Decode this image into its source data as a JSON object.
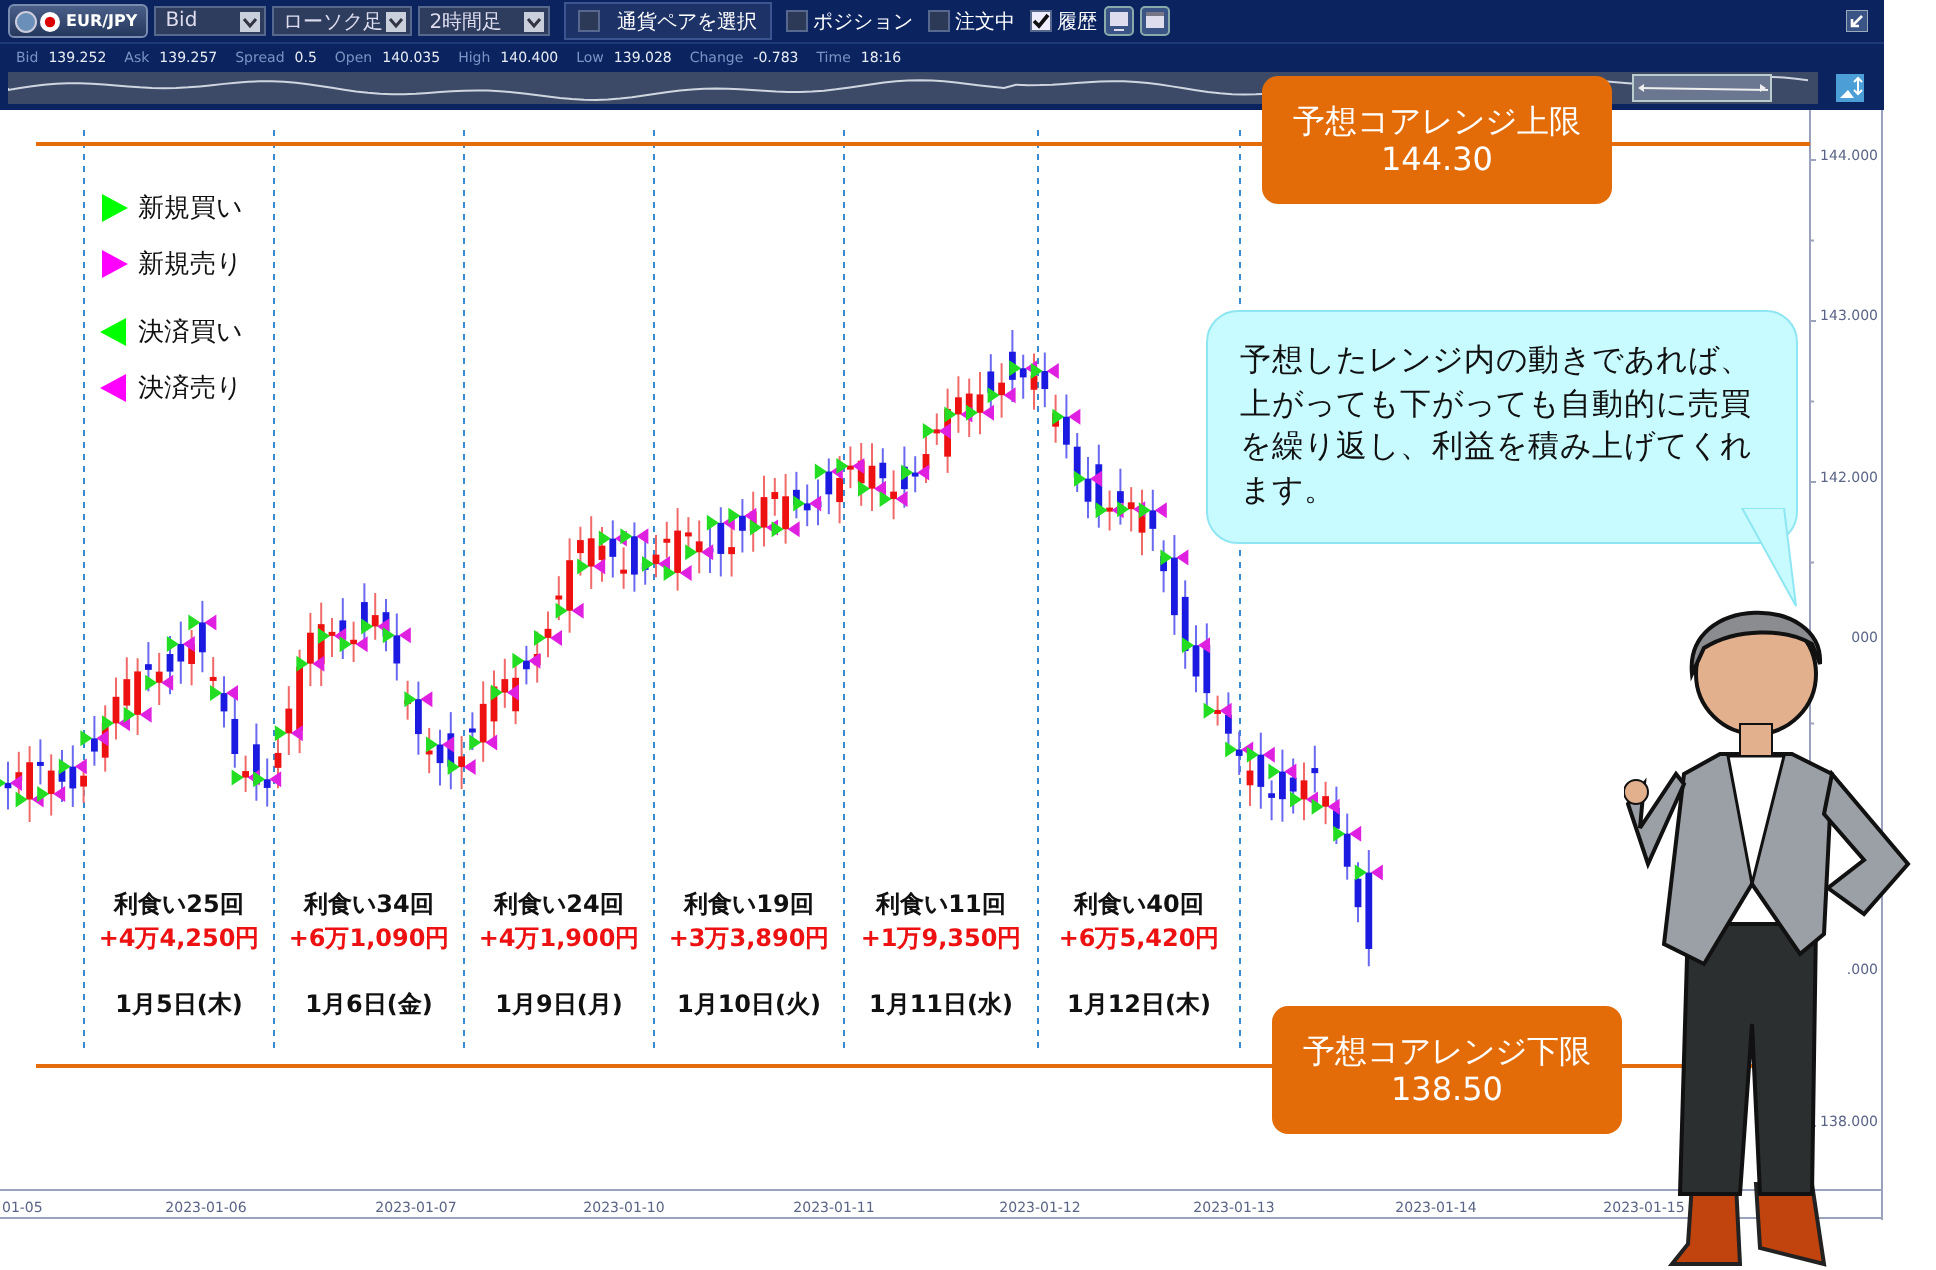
{
  "toolbar": {
    "pair_button": "EUR/JPY",
    "dropdowns": [
      {
        "value": "Bid"
      },
      {
        "value": "ローソク足"
      },
      {
        "value": "2時間足"
      }
    ],
    "pair_select": {
      "label": "通貨ペアを選択",
      "checked": false
    },
    "toggles": [
      {
        "label": "ポジション",
        "checked": false
      },
      {
        "label": "注文中",
        "checked": false
      },
      {
        "label": "履歴",
        "checked": true
      }
    ]
  },
  "quote_bar": [
    {
      "label": "Bid",
      "value": "139.252"
    },
    {
      "label": "Ask",
      "value": "139.257"
    },
    {
      "label": "Spread",
      "value": "0.5"
    },
    {
      "label": "Open",
      "value": "140.035"
    },
    {
      "label": "High",
      "value": "140.400"
    },
    {
      "label": "Low",
      "value": "139.028"
    },
    {
      "label": "Change",
      "value": "-0.783"
    },
    {
      "label": "Time",
      "value": "18:16"
    }
  ],
  "chart": {
    "y_axis_labels": [
      "144.000",
      "143.000",
      "142.000",
      "000",
      ".000",
      "138.000"
    ],
    "x_axis_labels": [
      "01-05",
      "2023-01-06",
      "2023-01-07",
      "2023-01-10",
      "2023-01-11",
      "2023-01-12",
      "2023-01-13",
      "2023-01-14",
      "2023-01-15"
    ],
    "legend": [
      {
        "label": "新規買い",
        "kind": "new",
        "color": "#00ff00"
      },
      {
        "label": "新規売り",
        "kind": "new",
        "color": "#ff00ff"
      },
      {
        "label": "決済買い",
        "kind": "close",
        "color": "#00ff00"
      },
      {
        "label": "決済売り",
        "kind": "close",
        "color": "#ff00ff"
      }
    ],
    "days": [
      {
        "count": "利食い25回",
        "profit": "+4万4,250円",
        "date": "1月5日(木)"
      },
      {
        "count": "利食い34回",
        "profit": "+6万1,090円",
        "date": "1月6日(金)"
      },
      {
        "count": "利食い24回",
        "profit": "+4万1,900円",
        "date": "1月9日(月)"
      },
      {
        "count": "利食い19回",
        "profit": "+3万3,890円",
        "date": "1月10日(火)"
      },
      {
        "count": "利食い11回",
        "profit": "+1万9,350円",
        "date": "1月11日(水)"
      },
      {
        "count": "利食い40回",
        "profit": "+6万5,420円",
        "date": "1月12日(木)"
      }
    ],
    "upper_band": {
      "title": "予想コアレンジ上限",
      "value": "144.30"
    },
    "lower_band": {
      "title": "予想コアレンジ下限",
      "value": "138.50"
    },
    "speech_bubble": "予想したレンジ内の動きであれば、上がっても下がっても自動的に売買を繰り返し、利益を積み上げてくれます。"
  }
}
